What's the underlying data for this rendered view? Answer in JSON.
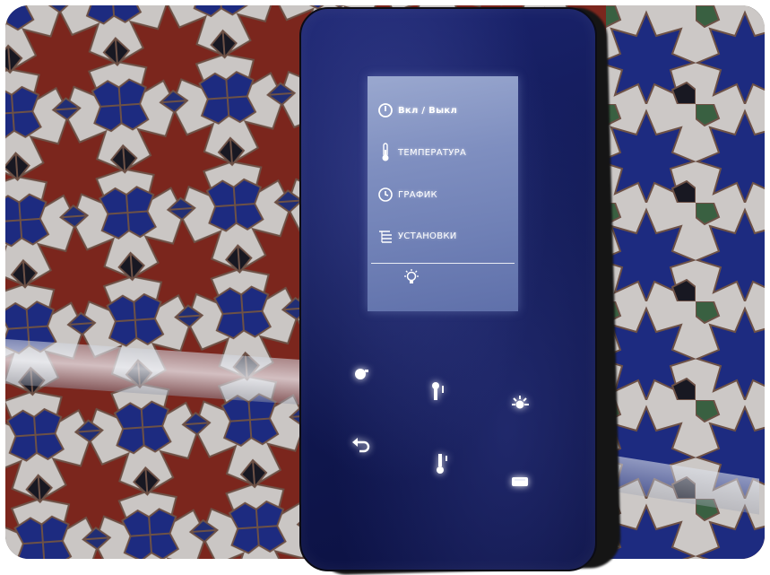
{
  "device": {
    "menu": [
      {
        "label": "Вкл / Выкл",
        "icon": "power-icon"
      },
      {
        "label": "ТЕМПЕРАТУРА",
        "icon": "thermometer-icon"
      },
      {
        "label": "ГРАФИК",
        "icon": "clock-icon"
      },
      {
        "label": "УСТАНОВКИ",
        "icon": "settings-icon"
      }
    ],
    "screen_footer_icon": "bulb-icon",
    "buttons": [
      {
        "name": "power-button",
        "icon": "power-icon"
      },
      {
        "name": "up-button",
        "icon": "thermometer-up-icon"
      },
      {
        "name": "light-button",
        "icon": "bulb-icon"
      },
      {
        "name": "back-button",
        "icon": "back-arrow-icon"
      },
      {
        "name": "down-button",
        "icon": "thermometer-down-icon"
      },
      {
        "name": "menu-button",
        "icon": "menu-icon"
      }
    ]
  },
  "colors": {
    "device_panel": "#121a55",
    "screen": "#7f8fc0",
    "tile_blue": "#1f2f8c",
    "tile_red": "#8a2a1c",
    "tile_white": "#e6e2dc",
    "tile_green": "#3f6b45"
  }
}
